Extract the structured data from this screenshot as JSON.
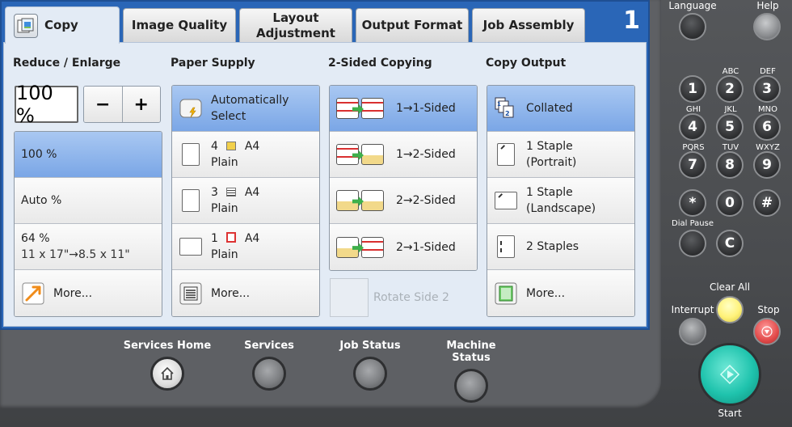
{
  "tabs": {
    "copy": "Copy",
    "image_quality": "Image Quality",
    "layout_adjustment_line1": "Layout",
    "layout_adjustment_line2": "Adjustment",
    "output_format": "Output Format",
    "job_assembly": "Job Assembly",
    "screen_number": "1"
  },
  "reduce_enlarge": {
    "title": "Reduce / Enlarge",
    "current_value": "100 %",
    "minus": "−",
    "plus": "+",
    "options": [
      {
        "label": "100 %",
        "selected": true
      },
      {
        "label": "Auto %",
        "selected": false
      },
      {
        "label": "64 %",
        "sub": "11 x 17\"→8.5 x 11\"",
        "selected": false
      },
      {
        "label": "More...",
        "selected": false
      }
    ]
  },
  "paper_supply": {
    "title": "Paper Supply",
    "options": [
      {
        "line1": "Automatically",
        "line2": "Select",
        "selected": true
      },
      {
        "tray": "4",
        "size": "A4",
        "type": "Plain"
      },
      {
        "tray": "3",
        "size": "A4",
        "type": "Plain"
      },
      {
        "tray": "1",
        "size": "A4",
        "type": "Plain"
      },
      {
        "label": "More..."
      }
    ]
  },
  "two_sided": {
    "title": "2-Sided Copying",
    "options": [
      {
        "label": "1→1-Sided",
        "selected": true
      },
      {
        "label": "1→2-Sided"
      },
      {
        "label": "2→2-Sided"
      },
      {
        "label": "2→1-Sided"
      }
    ],
    "rotate": "Rotate Side 2"
  },
  "copy_output": {
    "title": "Copy Output",
    "options": [
      {
        "label": "Collated",
        "selected": true
      },
      {
        "line1": "1 Staple",
        "line2": "(Portrait)"
      },
      {
        "line1": "1 Staple",
        "line2": "(Landscape)"
      },
      {
        "label": "2 Staples"
      },
      {
        "label": "More..."
      }
    ]
  },
  "bottom_buttons": {
    "services_home": "Services Home",
    "services": "Services",
    "job_status": "Job Status",
    "machine_status": "Machine Status"
  },
  "keypad": {
    "language": "Language",
    "help": "Help",
    "keys": [
      {
        "digit": "1",
        "letters": ""
      },
      {
        "digit": "2",
        "letters": "ABC"
      },
      {
        "digit": "3",
        "letters": "DEF"
      },
      {
        "digit": "4",
        "letters": "GHI"
      },
      {
        "digit": "5",
        "letters": "JKL"
      },
      {
        "digit": "6",
        "letters": "MNO"
      },
      {
        "digit": "7",
        "letters": "PQRS"
      },
      {
        "digit": "8",
        "letters": "TUV"
      },
      {
        "digit": "9",
        "letters": "WXYZ"
      },
      {
        "digit": "*",
        "letters": ""
      },
      {
        "digit": "0",
        "letters": ""
      },
      {
        "digit": "#",
        "letters": ""
      }
    ],
    "dial_pause": "Dial Pause",
    "clear": "C",
    "clear_all": "Clear All",
    "interrupt": "Interrupt",
    "stop": "Stop",
    "start": "Start"
  },
  "colors": {
    "screen_blue": "#2a66b7",
    "selected_blue": "#7aa6e6",
    "start_green": "#1fc3ad",
    "stop_red": "#e24a4a",
    "clear_all_yellow": "#fff27a"
  }
}
